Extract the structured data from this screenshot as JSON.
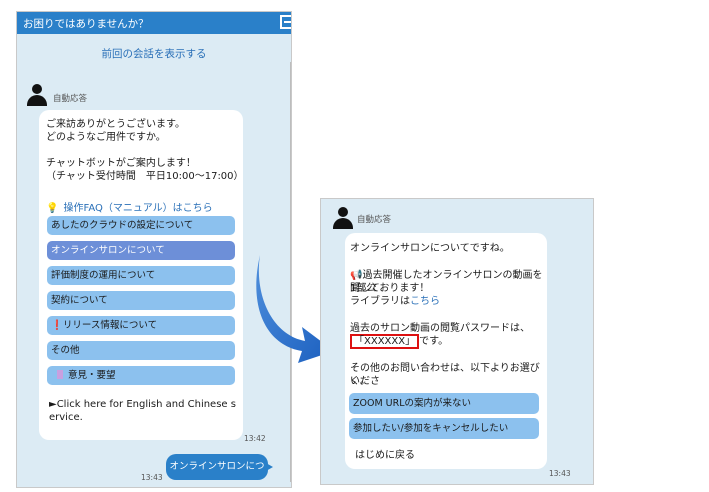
{
  "left_panel": {
    "title": "お困りではありませんか？",
    "prev_link": "前回の会話を表示する",
    "bot_name": "自動応答",
    "greeting_1": "ご来訪ありがとうございます。",
    "greeting_2": "どのようなご用件ですか。",
    "greeting_3": "チャットボットがご案内します！",
    "greeting_4": "（チャット受付時間　平日10:00～17:00）",
    "faq_text": "操作FAQ（マニュアル）はこちら",
    "options": [
      {
        "label": "あしたのクラウドの設定について"
      },
      {
        "label": "オンラインサロンについて"
      },
      {
        "label": "評価制度の運用について"
      },
      {
        "label": "契約について"
      },
      {
        "label": "リリース情報について"
      },
      {
        "label": "その他"
      },
      {
        "label": "意見・要望"
      }
    ],
    "english_1": "►Click here for English and Chinese s",
    "english_2": "ervice.",
    "bot_time": "13:42",
    "user_message": "オンラインサロンについて",
    "user_time": "13:43"
  },
  "right_panel": {
    "bot_name": "自動応答",
    "line_1": "オンラインサロンについてですね。",
    "line_2": "過去開催したオンラインサロンの動画を1部公",
    "line_3": "開しております！",
    "line_4_a": "ライブラリは",
    "line_4_link": "こちら",
    "line_5": "過去のサロン動画の閲覧パスワードは、",
    "password": "「XXXXXX」",
    "password_suffix": "です。",
    "line_6": "その他のお問い合わせは、以下よりお選びくださ",
    "line_7": "い。",
    "options": [
      {
        "label": "ZOOM URLの案内が来ない"
      },
      {
        "label": "参加したい/参加をキャンセルしたい"
      }
    ],
    "back_label": "はじめに戻る",
    "time": "13:43"
  },
  "colors": {
    "accent": "#2a80c9",
    "panel_bg": "#dcebf4",
    "option_bg": "#8cc1ee",
    "selected_option_bg": "#6d8fd8",
    "arrow": "#2168c4",
    "alert": "#dd1111"
  }
}
